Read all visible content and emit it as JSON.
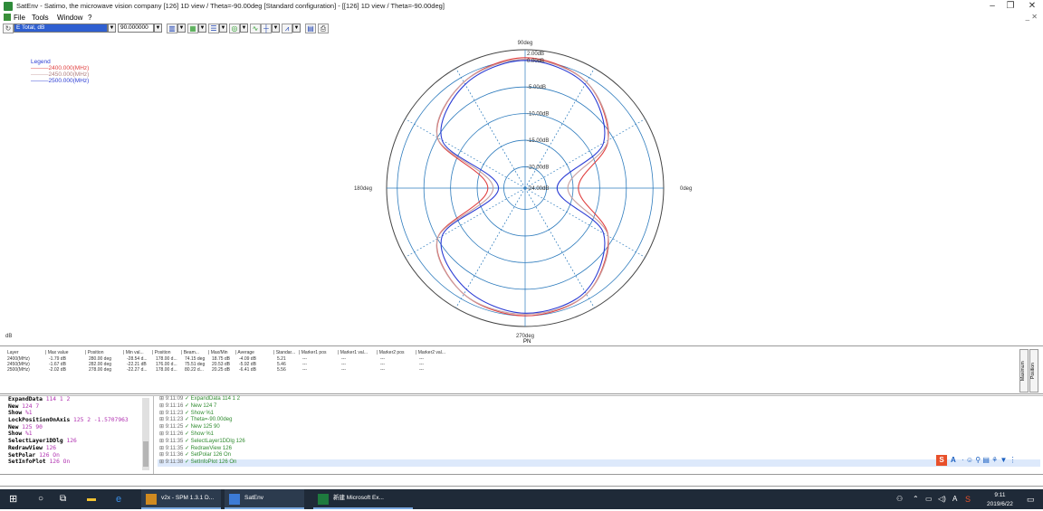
{
  "window": {
    "title": "SatEnv - Satimo, the microwave vision company [126] 1D view / Theta=-90.00deg [Standard configuration] - [[126] 1D view / Theta=-90.00deg]",
    "minimize_label": "–",
    "maximize_label": "❐",
    "close_label": "✕",
    "mdi_controls": "_ ✕"
  },
  "menu": {
    "items": [
      "File",
      "Tools",
      "Window",
      "?"
    ]
  },
  "toolbar": {
    "quantity_combo": "E Total, dB",
    "value_combo": "90.000000",
    "drop_glyph": "▼"
  },
  "plot": {
    "legend_title": "Legend",
    "legend_entries": [
      {
        "label": "2400.000(MHz)",
        "color": "#e04040"
      },
      {
        "label": "2450.000(MHz)",
        "color": "#c8a0a0"
      },
      {
        "label": "2500.000(MHz)",
        "color": "#2b3cd4"
      }
    ],
    "angle_labels": {
      "top": "90deg",
      "bottom": "270deg",
      "left": "180deg",
      "right": "0deg"
    },
    "ring_labels": [
      "0.00dB",
      "-5.00dB",
      "-10.00dB",
      "-15.00dB",
      "-20.00dB",
      "-24.00dB"
    ],
    "max_label": "2.00dB",
    "unit_label": "dB",
    "pn_label": "PN"
  },
  "chart_data": {
    "type": "polar",
    "title": "",
    "angular_labels": [
      "0deg",
      "90deg",
      "180deg",
      "270deg"
    ],
    "radial_range_db": [
      -24,
      2
    ],
    "radial_ticks_db": [
      2,
      0,
      -5,
      -10,
      -15,
      -20,
      -24
    ],
    "angles_deg": [
      0,
      30,
      60,
      90,
      120,
      150,
      180,
      210,
      240,
      270,
      300,
      330
    ],
    "series": [
      {
        "name": "2400.000(MHz)",
        "color": "#e04040",
        "values_db": [
          -14,
          -6,
          -1,
          0.5,
          -1,
          -5,
          -17,
          -5,
          -1,
          0,
          -1,
          -6
        ]
      },
      {
        "name": "2450.000(MHz)",
        "color": "#c8a0a0",
        "values_db": [
          -16,
          -6,
          -1,
          0.2,
          -1,
          -5,
          -18,
          -5,
          -1,
          -0.3,
          -1,
          -6
        ]
      },
      {
        "name": "2500.000(MHz)",
        "color": "#2b3cd4",
        "values_db": [
          -18,
          -7,
          -1.5,
          0,
          -1.5,
          -6,
          -19,
          -6,
          -2,
          -0.5,
          -1.5,
          -7
        ]
      }
    ]
  },
  "table": {
    "headers": [
      "Layer",
      "Max value",
      "Position",
      "Min val...",
      "Position",
      "Beam...",
      "Max/Min",
      "Average",
      "Standar...",
      "Marker1 pos",
      "Marker1 val...",
      "Marker2 pos",
      "Marker2 val..."
    ],
    "rows": [
      [
        "2400(MHz)",
        "-1.79 dB",
        "280.00 deg",
        "-28.54 d...",
        "178.00 d...",
        "74.15 deg",
        "18.75 dB",
        "-4.09 dB",
        "5.21",
        "---",
        "---",
        "---",
        "---"
      ],
      [
        "2450(MHz)",
        "-1.67 dB",
        "282.00 deg",
        "-22.21 dB",
        "176.00 d...",
        "75.51 deg",
        "20.53 dB",
        "-5.92 dB",
        "5.46",
        "---",
        "---",
        "---",
        "---"
      ],
      [
        "2500(MHz)",
        "-2.02 dB",
        "278.00 deg",
        "-22.27 d...",
        "178.00 d...",
        "80.22 d...",
        "20.25 dB",
        "-6.41 dB",
        "5.56",
        "---",
        "---",
        "---",
        "---"
      ]
    ],
    "side_tabs": [
      "Maximum",
      "Position"
    ]
  },
  "commands": [
    {
      "kw": "ExpandData",
      "args": "114 1 2"
    },
    {
      "kw": "New",
      "args": "124 7"
    },
    {
      "kw": "Show",
      "args": "%1"
    },
    {
      "kw": "LockPositionOnAxis",
      "args": "125 2 -1.5707963"
    },
    {
      "kw": "New",
      "args": "125 90"
    },
    {
      "kw": "Show",
      "args": "%1"
    },
    {
      "kw": "SelectLayer1DDlg",
      "args": "126"
    },
    {
      "kw": "RedrawView",
      "args": "126"
    },
    {
      "kw": "SetPolar",
      "args": "126 On"
    },
    {
      "kw": "SetInfoPlot",
      "args": "126 On"
    }
  ],
  "log": [
    {
      "time": "9:11:09",
      "text": "ExpandData 114 1 2"
    },
    {
      "time": "9:11:16",
      "text": "New 124 7"
    },
    {
      "time": "9:11:23",
      "text": "Show %1"
    },
    {
      "time": "9:11:23",
      "text": "Theta=-90.00deg"
    },
    {
      "time": "9:11:25",
      "text": "New 125 90"
    },
    {
      "time": "9:11:26",
      "text": "Show %1"
    },
    {
      "time": "9:11:35",
      "text": "SelectLayer1DDlg 126"
    },
    {
      "time": "9:11:35",
      "text": "RedrawView 126"
    },
    {
      "time": "9:11:36",
      "text": "SetPolar 126 On"
    },
    {
      "time": "9:11:38",
      "text": "SetInfoPlot 126 On"
    }
  ],
  "taskbar": {
    "apps": [
      {
        "label": "v2x - SPM 1.3.1 D..."
      },
      {
        "label": "SatEnv"
      },
      {
        "label": "新建 Microsoft Ex..."
      }
    ],
    "time": "9:11",
    "date": "2019/6/22",
    "ime_label": "A"
  }
}
